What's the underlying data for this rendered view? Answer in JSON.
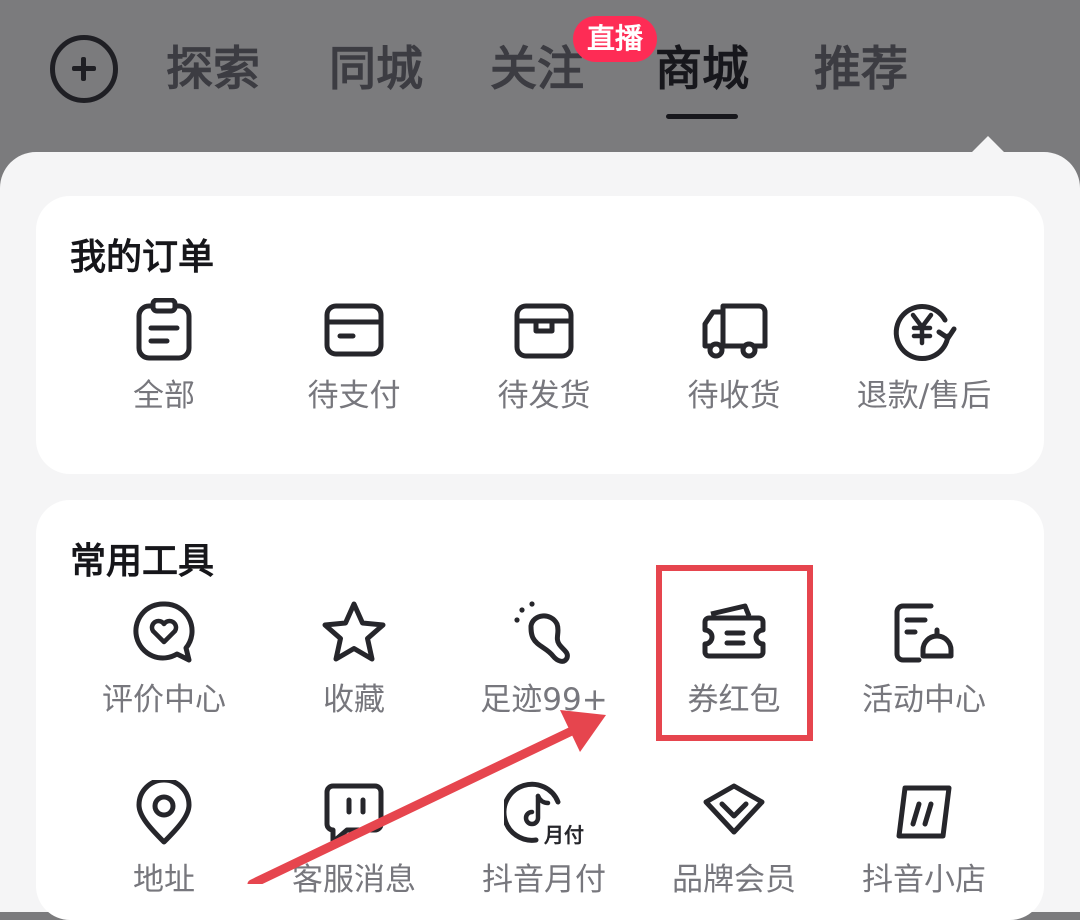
{
  "header": {
    "tabs": [
      {
        "label": "探索"
      },
      {
        "label": "同城"
      },
      {
        "label": "关注"
      },
      {
        "label": "商城"
      },
      {
        "label": "推荐"
      }
    ],
    "live_badge": "直播",
    "active_tab": "商城"
  },
  "orders": {
    "title": "我的订单",
    "items": [
      {
        "label": "全部",
        "icon": "clipboard-icon"
      },
      {
        "label": "待支付",
        "icon": "card-icon"
      },
      {
        "label": "待发货",
        "icon": "box-icon"
      },
      {
        "label": "待收货",
        "icon": "truck-icon"
      },
      {
        "label": "退款/售后",
        "icon": "refund-icon"
      }
    ]
  },
  "tools": {
    "title": "常用工具",
    "items": [
      {
        "label": "评价中心",
        "icon": "heart-bubble-icon"
      },
      {
        "label": "收藏",
        "icon": "star-icon"
      },
      {
        "label": "足迹99+",
        "icon": "footprint-icon"
      },
      {
        "label": "券红包",
        "icon": "coupon-icon"
      },
      {
        "label": "活动中心",
        "icon": "bell-doc-icon"
      },
      {
        "label": "地址",
        "icon": "location-icon"
      },
      {
        "label": "客服消息",
        "icon": "service-chat-icon"
      },
      {
        "label": "抖音月付",
        "icon": "monthly-pay-icon"
      },
      {
        "label": "品牌会员",
        "icon": "diamond-icon"
      },
      {
        "label": "抖音小店",
        "icon": "shop-icon"
      }
    ],
    "monthly_pay_badge": "月付"
  },
  "colors": {
    "header_bg": "#7b7b7d",
    "live_badge": "#fe2c55",
    "highlight": "#e6454e",
    "icon": "#26262b",
    "label": "#77777d"
  }
}
